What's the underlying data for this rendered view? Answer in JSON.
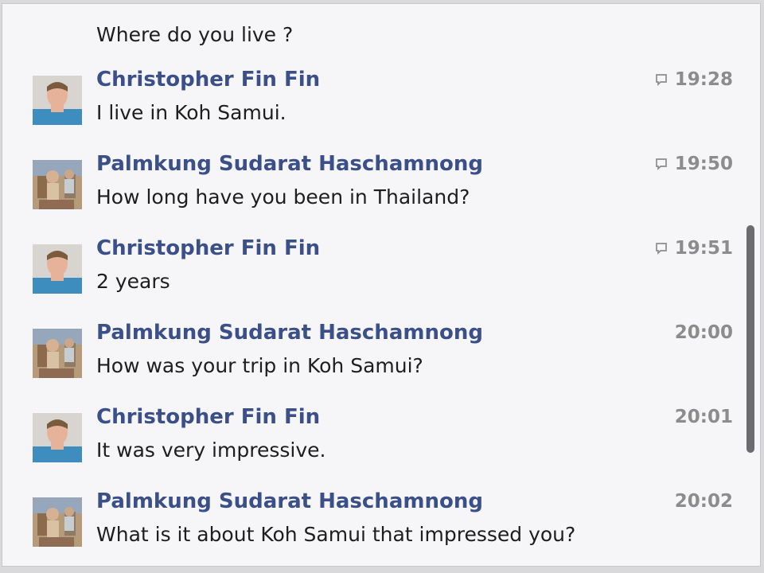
{
  "chat": {
    "first_line": "Where do you live ?",
    "messages": [
      {
        "sender": "Christopher Fin Fin",
        "text": "I live in Koh Samui.",
        "time": "19:28",
        "has_comment_icon": true,
        "avatar": "christopher-avatar"
      },
      {
        "sender": "Palmkung Sudarat Haschamnong",
        "text": "How long have you been in Thailand?",
        "time": "19:50",
        "has_comment_icon": true,
        "avatar": "palmkung-avatar"
      },
      {
        "sender": "Christopher Fin Fin",
        "text": "2 years",
        "time": "19:51",
        "has_comment_icon": true,
        "avatar": "christopher-avatar"
      },
      {
        "sender": "Palmkung Sudarat Haschamnong",
        "text": "How was your trip in Koh Samui?",
        "time": "20:00",
        "has_comment_icon": false,
        "avatar": "palmkung-avatar"
      },
      {
        "sender": "Christopher Fin Fin",
        "text": "It was very impressive.",
        "time": "20:01",
        "has_comment_icon": false,
        "avatar": "christopher-avatar"
      },
      {
        "sender": "Palmkung Sudarat Haschamnong",
        "text": "What is it about Koh Samui that impressed you?",
        "time": "20:02",
        "has_comment_icon": false,
        "avatar": "palmkung-avatar"
      }
    ]
  },
  "colors": {
    "sender": "#3b4f88",
    "text": "#1e1e1e",
    "time": "#8c8c8c",
    "panel": "#f6f5f8"
  },
  "icons": {
    "comment": "comment-bubble-icon",
    "scrollbar": "scrollbar-thumb"
  }
}
